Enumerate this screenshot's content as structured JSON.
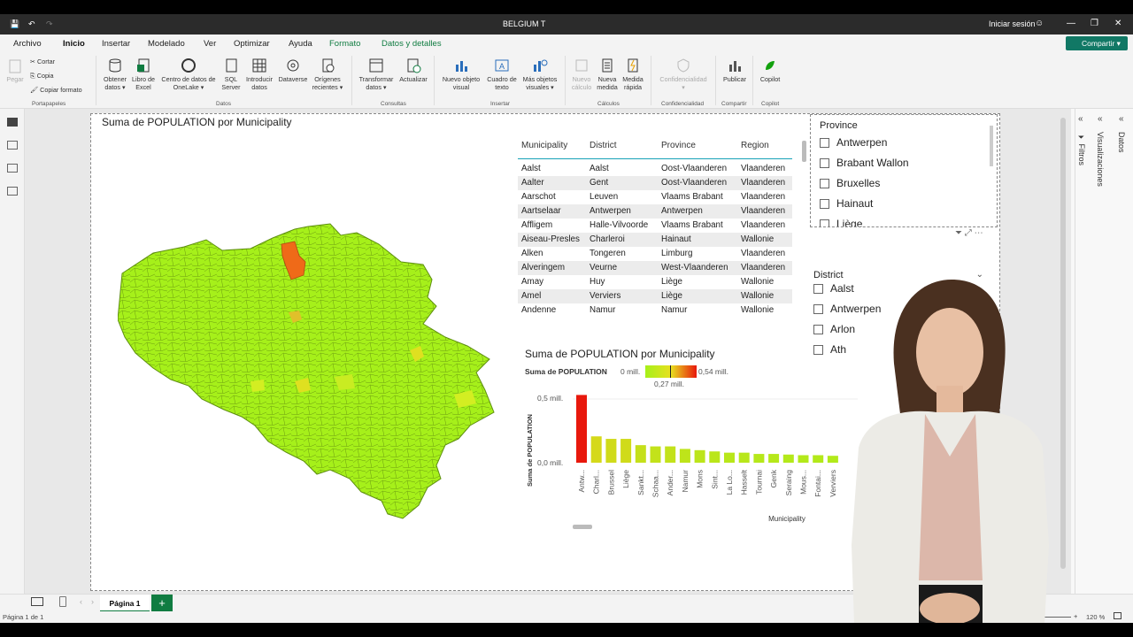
{
  "window": {
    "title": "BELGIUM T",
    "signin": "Iniciar sesión"
  },
  "menu": {
    "items": [
      "Archivo",
      "Inicio",
      "Insertar",
      "Modelado",
      "Ver",
      "Optimizar",
      "Ayuda",
      "Formato",
      "Datos y detalles"
    ],
    "share": "Compartir"
  },
  "ribbon": {
    "clipboard": {
      "paste": "Pegar",
      "cut": "Cortar",
      "copy": "Copia",
      "format": "Copiar formato",
      "group": "Portapapeles"
    },
    "data": {
      "get": "Obtener datos",
      "excel": "Libro de Excel",
      "onelake": "Centro de datos de OneLake",
      "sql": "SQL Server",
      "enter": "Introducir datos",
      "dataverse": "Dataverse",
      "recent": "Orígenes recientes",
      "group": "Datos"
    },
    "queries": {
      "transform": "Transformar datos",
      "refresh": "Actualizar",
      "group": "Consultas"
    },
    "insert": {
      "visual": "Nuevo objeto visual",
      "textbox": "Cuadro de texto",
      "more": "Más objetos visuales",
      "group": "Insertar"
    },
    "calc": {
      "newcalc": "Nuevo cálculo",
      "measure": "Nueva medida",
      "quick": "Medida rápida",
      "group": "Cálculos"
    },
    "sens": {
      "label": "Confidencialidad",
      "group": "Confidencialidad"
    },
    "share": {
      "publish": "Publicar",
      "group": "Compartir"
    },
    "copilot": {
      "label": "Copilot",
      "group": "Copilot"
    }
  },
  "map": {
    "title": "Suma de POPULATION por Municipality"
  },
  "table": {
    "headers": [
      "Municipality",
      "District",
      "Province",
      "Region"
    ],
    "rows": [
      [
        "Aalst",
        "Aalst",
        "Oost-Vlaanderen",
        "Vlaanderen"
      ],
      [
        "Aalter",
        "Gent",
        "Oost-Vlaanderen",
        "Vlaanderen"
      ],
      [
        "Aarschot",
        "Leuven",
        "Vlaams Brabant",
        "Vlaanderen"
      ],
      [
        "Aartselaar",
        "Antwerpen",
        "Antwerpen",
        "Vlaanderen"
      ],
      [
        "Affligem",
        "Halle-Vilvoorde",
        "Vlaams Brabant",
        "Vlaanderen"
      ],
      [
        "Aiseau-Presles",
        "Charleroi",
        "Hainaut",
        "Wallonie"
      ],
      [
        "Alken",
        "Tongeren",
        "Limburg",
        "Vlaanderen"
      ],
      [
        "Alveringem",
        "Veurne",
        "West-Vlaanderen",
        "Vlaanderen"
      ],
      [
        "Amay",
        "Huy",
        "Liège",
        "Wallonie"
      ],
      [
        "Amel",
        "Verviers",
        "Liège",
        "Wallonie"
      ],
      [
        "Andenne",
        "Namur",
        "Namur",
        "Wallonie"
      ]
    ]
  },
  "province": {
    "title": "Province",
    "items": [
      "Antwerpen",
      "Brabant Wallon",
      "Bruxelles",
      "Hainaut",
      "Liège"
    ]
  },
  "district": {
    "title": "District",
    "items": [
      "Aalst",
      "Antwerpen",
      "Arlon",
      "Ath"
    ]
  },
  "chart_data": {
    "type": "bar",
    "title": "Suma de POPULATION por Municipality",
    "legend": {
      "label": "Suma de POPULATION",
      "min": "0 mill.",
      "mid": "0,27 mill.",
      "max": "0,54 mill."
    },
    "xlabel": "Municipality",
    "ylabel": "Suma de POPULATION",
    "yticks": [
      "0,5 mill.",
      "0,0 mill."
    ],
    "ylim": [
      0,
      0.55
    ],
    "categories": [
      "Antw...",
      "Charl...",
      "Brussel",
      "Liège",
      "Sankt...",
      "Schaa...",
      "Ander...",
      "Namur",
      "Mons",
      "Sint...",
      "La Lo...",
      "Hasselt",
      "Tournai",
      "Genk",
      "Seraing",
      "Mous...",
      "Fontai...",
      "Verviers"
    ],
    "values": [
      0.54,
      0.21,
      0.19,
      0.19,
      0.14,
      0.13,
      0.13,
      0.11,
      0.1,
      0.09,
      0.08,
      0.08,
      0.07,
      0.07,
      0.065,
      0.06,
      0.06,
      0.055
    ]
  },
  "pages": {
    "tab": "Página 1"
  },
  "status": {
    "page": "Página 1 de 1",
    "zoom": "120 %"
  },
  "panes": {
    "filters": "Filtros",
    "vis": "Visualizaciones",
    "data": "Datos"
  },
  "colors": {
    "accent": "#107c41",
    "map_fill": "#a6f01a",
    "high": "#e8180c"
  }
}
